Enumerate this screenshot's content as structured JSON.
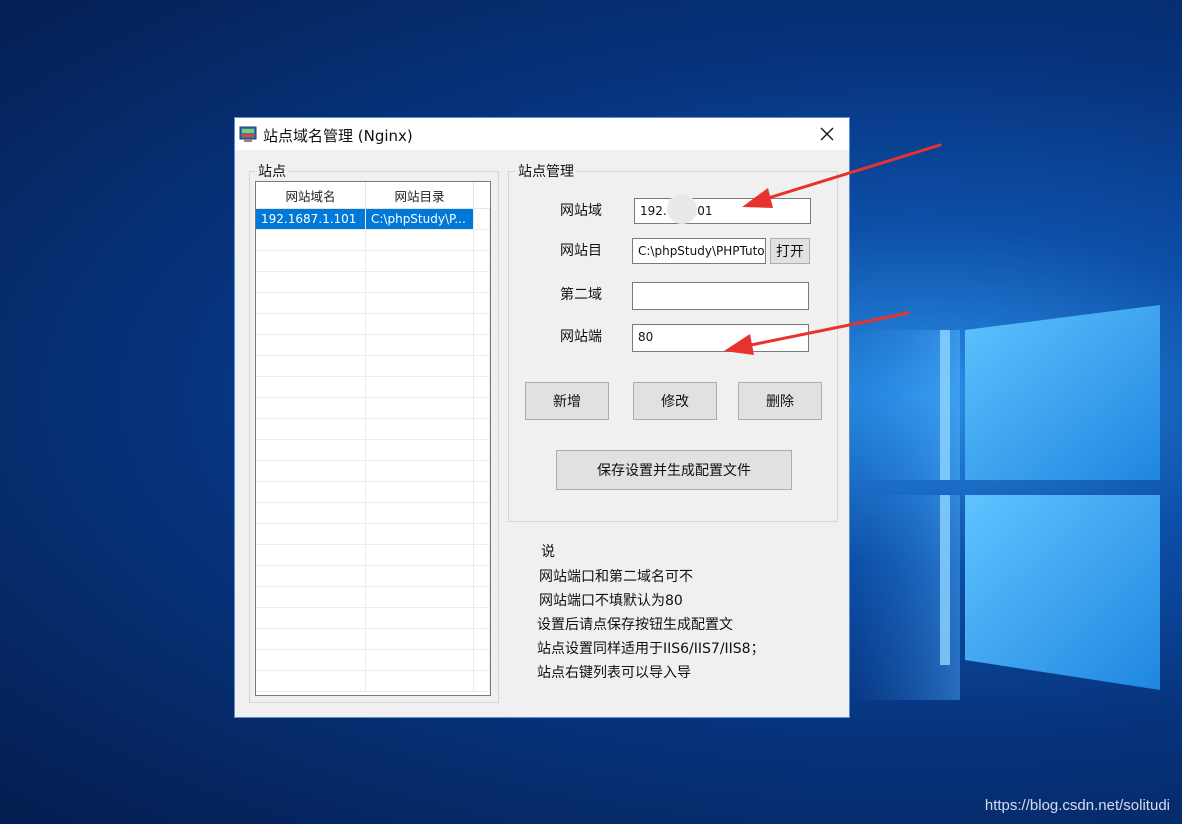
{
  "dialog": {
    "title": "站点域名管理 (Nginx)",
    "left_group_label": "站点",
    "right_group_label": "站点管理"
  },
  "sites_table": {
    "columns": [
      "网站域名",
      "网站目录"
    ],
    "rows": [
      {
        "domain": "192.1687.1.101",
        "dir": "C:\\phpStudy\\P..."
      }
    ],
    "empty_rows": 22
  },
  "form": {
    "domain_label": "网站域",
    "domain_value": "192.1      1.101",
    "dir_label": "网站目",
    "dir_value": "C:\\phpStudy\\PHPTutor",
    "open_button": "打开",
    "second_domain_label": "第二域",
    "second_domain_value": "",
    "port_label": "网站端",
    "port_value": "80"
  },
  "buttons": {
    "add": "新增",
    "edit": "修改",
    "delete": "删除",
    "save": "保存设置并生成配置文件"
  },
  "notes": {
    "title": "说",
    "lines": [
      "网站端口和第二域名可不",
      "网站端口不填默认为80",
      "设置后请点保存按钮生成配置文",
      "站点设置同样适用于IIS6/IIS7/IIS8；",
      "站点右键列表可以导入导"
    ]
  },
  "watermark": "https://blog.csdn.net/solitudi",
  "colors": {
    "selection": "#0078d7",
    "annotation_arrow": "#e8322e",
    "desktop": "#07347e"
  }
}
